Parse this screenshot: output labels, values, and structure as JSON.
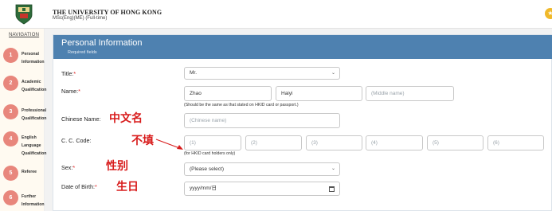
{
  "header": {
    "university": "THE UNIVERSITY OF HONG KONG",
    "programme": "MSc(Eng)(ME) (Full-time)"
  },
  "nav": {
    "title": "NAVIGATION",
    "steps": [
      {
        "num": "1",
        "label": "Personal Information"
      },
      {
        "num": "2",
        "label": "Academic Qualification"
      },
      {
        "num": "3",
        "label": "Professional Qualification"
      },
      {
        "num": "4",
        "label": "English Language Qualification"
      },
      {
        "num": "5",
        "label": "Referee"
      },
      {
        "num": "6",
        "label": "Further Information"
      }
    ]
  },
  "panel": {
    "title": "Personal Information",
    "subtitle": "Required fields"
  },
  "form": {
    "title_label": "Title:",
    "title_value": "Mr.",
    "name_label": "Name:",
    "surname_value": "Zhao",
    "given_value": "Haiyi",
    "middle_placeholder": "(Middle name)",
    "name_note": "(Should be the same as that stated on HKID card or passport.)",
    "chinese_label": "Chinese Name:",
    "chinese_placeholder": "(Chinese name)",
    "cc_label": "C. C. Code:",
    "cc_boxes": [
      "(1)",
      "(2)",
      "(3)",
      "(4)",
      "(5)",
      "(6)"
    ],
    "cc_note": "(for HKID card holders only)",
    "sex_label": "Sex:",
    "sex_value": "(Please select)",
    "dob_label": "Date of Birth:",
    "dob_value": "yyyy/mm/日",
    "required_mark": "*"
  },
  "annotations": {
    "chinese_name": "中文名",
    "cc_code": "不填",
    "sex": "性别",
    "dob": "生日"
  },
  "colors": {
    "panel_header": "#4e81b0",
    "step_circle": "#e8867c",
    "annotation": "#d81c1c"
  }
}
